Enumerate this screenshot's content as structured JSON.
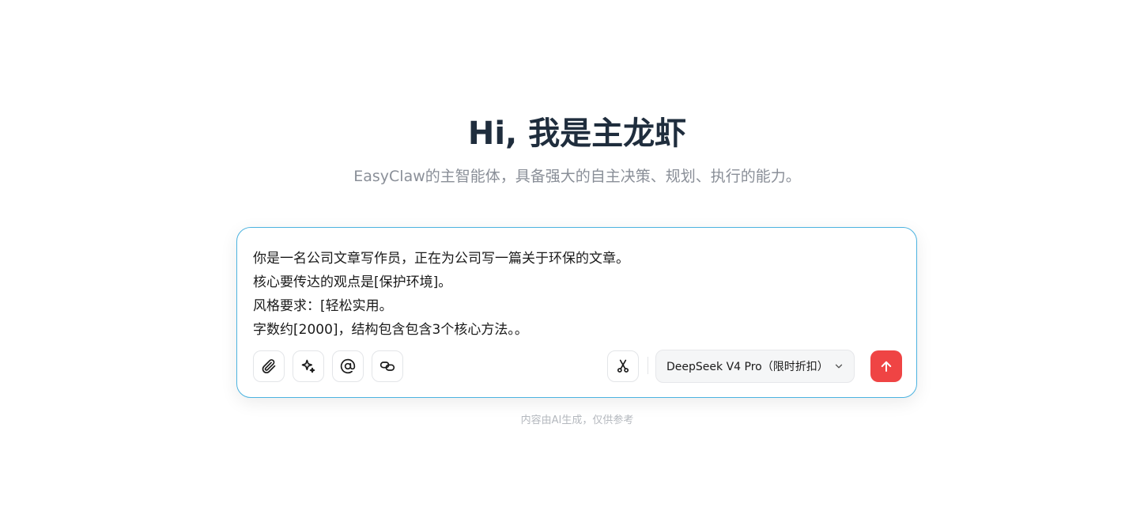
{
  "hero": {
    "title": "Hi, 我是主龙虾",
    "subtitle": "EasyClaw的主智能体，具备强大的自主决策、规划、执行的能力。"
  },
  "composer": {
    "prompt_lines": [
      "你是一名公司文章写作员，正在为公司写一篇关于环保的文章。",
      "核心要传达的观点是[保护环境]。",
      "风格要求：[轻松实用。",
      "字数约[2000]，结构包含包含3个核心方法。。"
    ],
    "tools": [
      {
        "name": "attach-button",
        "icon": "paperclip-icon"
      },
      {
        "name": "skills-button",
        "icon": "sparkles-icon"
      },
      {
        "name": "mention-button",
        "icon": "at-sign-icon"
      },
      {
        "name": "link-button",
        "icon": "link-icon"
      }
    ],
    "clip_icon": "scissors-icon",
    "model": {
      "selected": "DeepSeek V4 Pro（限时折扣）",
      "icon": "chevron-down-icon"
    },
    "send_icon": "arrow-up-icon",
    "accent_color": "#ef4444",
    "border_color": "#4cb3e0"
  },
  "footer": {
    "disclaimer": "内容由AI生成，仅供参考"
  }
}
